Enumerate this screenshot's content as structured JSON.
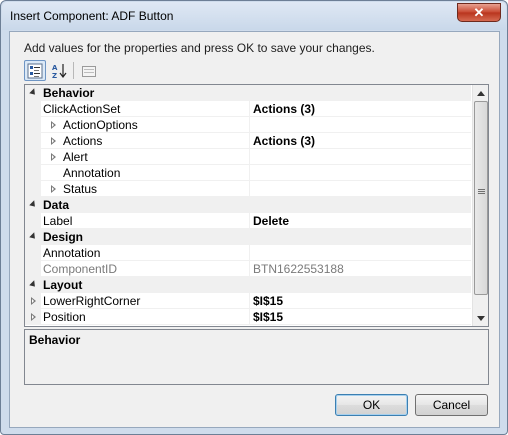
{
  "window": {
    "title": "Insert Component: ADF Button",
    "close_glyph": "✕"
  },
  "instruction": "Add values for the properties and press OK to save your changes.",
  "toolbar": {
    "items": [
      {
        "name": "categorized-view",
        "icon": "categorized-icon",
        "pressed": true
      },
      {
        "name": "alphabetical-view",
        "icon": "sort-az-icon",
        "pressed": false
      },
      {
        "name": "property-pages",
        "icon": "property-pages-icon",
        "pressed": false
      }
    ]
  },
  "grid": {
    "rows": [
      {
        "kind": "category",
        "label": "Behavior",
        "expanded": true
      },
      {
        "kind": "property",
        "label": "ClickActionSet",
        "value": "Actions (3)",
        "value_bold": true,
        "expandable": false,
        "level": 0,
        "readonly": false
      },
      {
        "kind": "property",
        "label": "ActionOptions",
        "value": "",
        "value_bold": false,
        "expandable": true,
        "level": 1,
        "readonly": false
      },
      {
        "kind": "property",
        "label": "Actions",
        "value": "Actions (3)",
        "value_bold": true,
        "expandable": true,
        "level": 1,
        "readonly": false
      },
      {
        "kind": "property",
        "label": "Alert",
        "value": "",
        "value_bold": false,
        "expandable": true,
        "level": 1,
        "readonly": false
      },
      {
        "kind": "property",
        "label": "Annotation",
        "value": "",
        "value_bold": false,
        "expandable": false,
        "level": 1,
        "readonly": false
      },
      {
        "kind": "property",
        "label": "Status",
        "value": "",
        "value_bold": false,
        "expandable": true,
        "level": 1,
        "readonly": false
      },
      {
        "kind": "category",
        "label": "Data",
        "expanded": true
      },
      {
        "kind": "property",
        "label": "Label",
        "value": "Delete",
        "value_bold": true,
        "expandable": false,
        "level": 0,
        "readonly": false
      },
      {
        "kind": "category",
        "label": "Design",
        "expanded": true
      },
      {
        "kind": "property",
        "label": "Annotation",
        "value": "",
        "value_bold": false,
        "expandable": false,
        "level": 0,
        "readonly": false
      },
      {
        "kind": "property",
        "label": "ComponentID",
        "value": "BTN1622553188",
        "value_bold": false,
        "expandable": false,
        "level": 0,
        "readonly": true
      },
      {
        "kind": "category",
        "label": "Layout",
        "expanded": true
      },
      {
        "kind": "property",
        "label": "LowerRightCorner",
        "value": "$I$15",
        "value_bold": true,
        "expandable": true,
        "level": 0,
        "readonly": false
      },
      {
        "kind": "property",
        "label": "Position",
        "value": "$I$15",
        "value_bold": true,
        "expandable": true,
        "level": 0,
        "readonly": false
      }
    ]
  },
  "description": {
    "title": "Behavior"
  },
  "buttons": {
    "ok": "OK",
    "cancel": "Cancel"
  },
  "colors": {
    "window_frame": "#cfdcec",
    "client": "#f0f0f0",
    "close": "#c7462f",
    "readonly_text": "#7a7a7a"
  }
}
